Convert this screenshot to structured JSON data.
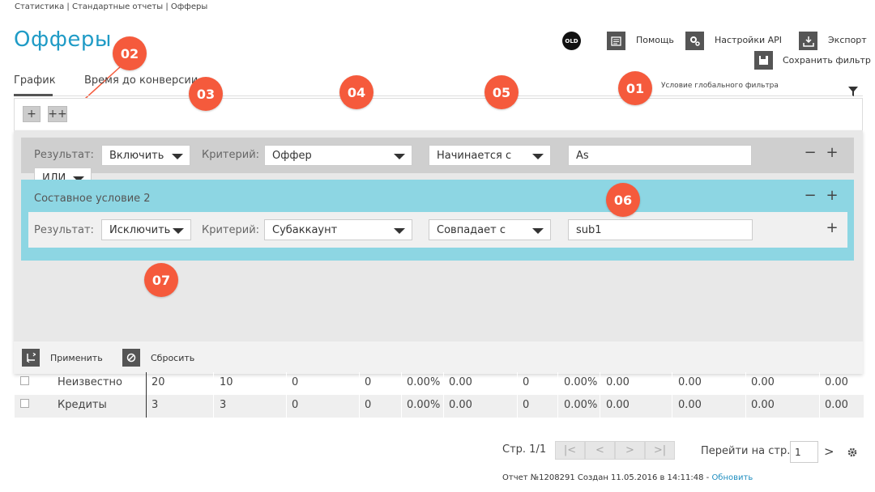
{
  "breadcrumb": "Статистика | Стандартные отчеты | Офферы",
  "page_title": "Офферы",
  "header": {
    "old_badge": "OLD",
    "help_label": "Помощь",
    "api_settings_label": "Настройки API",
    "export_label": "Экспорт",
    "save_filter_label": "Сохранить фильтр"
  },
  "tabs": [
    {
      "label": "График",
      "active": true
    },
    {
      "label": "Время до конверсии",
      "active": false
    }
  ],
  "global_filter_label": "Условие глобального фильтра",
  "filter_bar": {
    "add_label": "+",
    "add_compound_label": "++"
  },
  "condition1": {
    "result_label": "Результат:",
    "result_value": "Включить",
    "criterion_label": "Критерий:",
    "criterion_value": "Оффер",
    "operator_value": "Начинается с",
    "input_value": "As"
  },
  "logic_select": "ИЛИ",
  "compound": {
    "title": "Составное условие 2",
    "result_label": "Результат:",
    "result_value": "Исключить",
    "criterion_label": "Критерий:",
    "criterion_value": "Субаккаунт",
    "operator_value": "Совпадает с",
    "input_value": "sub1"
  },
  "footer": {
    "apply_label": "Применить",
    "reset_label": "Сбросить"
  },
  "table_rows": [
    {
      "name": "Неизвестно",
      "c1": "20",
      "c2": "10",
      "c3": "0",
      "c4": "0",
      "c5": "0.00%",
      "c6": "0.00",
      "c7": "0",
      "c8": "0.00%",
      "c9": "0.00",
      "c10": "0.00",
      "c11": "0.00",
      "c12": "0.00"
    },
    {
      "name": "Кредиты",
      "c1": "3",
      "c2": "3",
      "c3": "0",
      "c4": "0",
      "c5": "0.00%",
      "c6": "0.00",
      "c7": "0",
      "c8": "0.00%",
      "c9": "0.00",
      "c10": "0.00",
      "c11": "0.00",
      "c12": "0.00"
    }
  ],
  "pagination": {
    "page_label": "Стр. 1/1",
    "first": "|<",
    "prev": "<",
    "next": ">",
    "last": ">|",
    "goto_label": "Перейти на стр.",
    "goto_value": "1",
    "go_arrow": ">"
  },
  "report": {
    "text": "Отчет №1208291 Создан 11.05.2016 в 14:11:48 - ",
    "refresh_link": "Обновить"
  },
  "callouts": [
    "01",
    "02",
    "03",
    "04",
    "05",
    "06",
    "07"
  ],
  "colors": {
    "accent": "#1f9bc6",
    "callout": "#f55a3c",
    "compound_bg": "#8dd6e3"
  }
}
